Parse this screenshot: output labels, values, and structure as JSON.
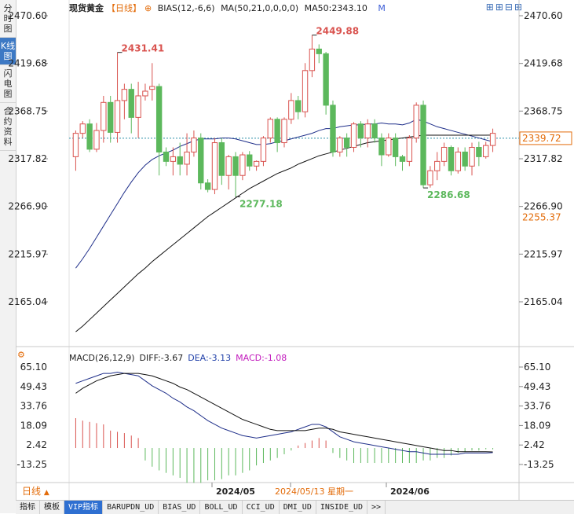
{
  "side_tabs": [
    {
      "label": "分时图",
      "active": false
    },
    {
      "label": "K线图",
      "active": true
    },
    {
      "label": "闪电图",
      "active": false
    },
    {
      "label": "合约资料",
      "active": false
    }
  ],
  "header": {
    "symbol": "现货黄金",
    "timeframe": "【日线】",
    "bias_label": "BIAS(12,-6,6)",
    "ma_label": "MA(50,21,0,0,0,0)",
    "ma_value": "MA50:2343.10",
    "m_label": "M"
  },
  "tools_icons": [
    "crosshair-icon",
    "zoom-in-icon",
    "zoom-out-icon",
    "layout-icon"
  ],
  "macd_header": {
    "label": "MACD(26,12,9)",
    "diff": "DIFF:-3.67",
    "dea": "DEA:-3.13",
    "macd": "MACD:-1.08"
  },
  "timeframe_select": "日线",
  "bottom_tabs": [
    "指标",
    "模板",
    "VIP指标",
    "BARUPDN_UD",
    "BIAS_UD",
    "BOLL_UD",
    "CCI_UD",
    "DMI_UD",
    "INSIDE_UD",
    ">>"
  ],
  "bottom_active_tab": "VIP指标",
  "colors": {
    "up": "#d9534f",
    "down": "#5cb85c",
    "ma_line": "#1f2f8a",
    "ma50_line": "#111111",
    "accent": "#e36c0a",
    "dea_line": "#111111"
  },
  "chart_data": [
    {
      "type": "candlestick",
      "title": "现货黄金",
      "y_ticks": [
        "2470.60",
        "2419.68",
        "2368.75",
        "2317.82",
        "2266.90",
        "2215.97",
        "2165.04"
      ],
      "ylim": [
        2125,
        2480
      ],
      "x_labels": [
        "2024/05",
        "2024/05/13 星期一",
        "2024/06"
      ],
      "last_price": "2339.72",
      "highlight_price": "2255.37",
      "annotations": [
        {
          "text": "2431.41",
          "value": 2431.41,
          "kind": "high"
        },
        {
          "text": "2449.88",
          "value": 2449.88,
          "kind": "high"
        },
        {
          "text": "2277.18",
          "value": 2277.18,
          "kind": "low"
        },
        {
          "text": "2286.68",
          "value": 2286.68,
          "kind": "low"
        }
      ],
      "candles": [
        [
          2320,
          2345,
          2305,
          2348
        ],
        [
          2345,
          2355,
          2340,
          2358
        ],
        [
          2355,
          2328,
          2325,
          2360
        ],
        [
          2328,
          2348,
          2325,
          2356
        ],
        [
          2348,
          2378,
          2335,
          2385
        ],
        [
          2378,
          2346,
          2335,
          2385
        ],
        [
          2346,
          2380,
          2335,
          2431.41
        ],
        [
          2380,
          2392,
          2360,
          2398
        ],
        [
          2392,
          2362,
          2345,
          2398
        ],
        [
          2362,
          2385,
          2340,
          2400
        ],
        [
          2385,
          2390,
          2380,
          2398
        ],
        [
          2392,
          2395,
          2380,
          2420
        ],
        [
          2395,
          2325,
          2300,
          2398
        ],
        [
          2325,
          2315,
          2310,
          2330
        ],
        [
          2315,
          2320,
          2300,
          2330
        ],
        [
          2320,
          2312,
          2300,
          2335
        ],
        [
          2312,
          2325,
          2300,
          2345
        ],
        [
          2325,
          2340,
          2320,
          2348
        ],
        [
          2340,
          2292,
          2285,
          2345
        ],
        [
          2292,
          2285,
          2282,
          2296
        ],
        [
          2285,
          2335,
          2280,
          2340
        ],
        [
          2335,
          2300,
          2290,
          2340
        ],
        [
          2300,
          2320,
          2285,
          2322
        ],
        [
          2320,
          2300,
          2277.18,
          2325
        ],
        [
          2300,
          2322,
          2295,
          2325
        ],
        [
          2322,
          2310,
          2305,
          2326
        ],
        [
          2310,
          2315,
          2305,
          2316
        ],
        [
          2315,
          2340,
          2310,
          2342
        ],
        [
          2340,
          2360,
          2335,
          2362
        ],
        [
          2360,
          2335,
          2325,
          2362
        ],
        [
          2335,
          2360,
          2330,
          2362
        ],
        [
          2360,
          2380,
          2355,
          2388
        ],
        [
          2380,
          2368,
          2360,
          2385
        ],
        [
          2368,
          2412,
          2362,
          2420
        ],
        [
          2412,
          2435,
          2405,
          2449.88
        ],
        [
          2435,
          2430,
          2420,
          2440
        ],
        [
          2430,
          2375,
          2365,
          2432
        ],
        [
          2375,
          2325,
          2320,
          2380
        ],
        [
          2325,
          2340,
          2320,
          2342
        ],
        [
          2340,
          2330,
          2320,
          2345
        ],
        [
          2330,
          2355,
          2325,
          2357
        ],
        [
          2355,
          2340,
          2330,
          2358
        ],
        [
          2340,
          2355,
          2330,
          2360
        ],
        [
          2355,
          2340,
          2335,
          2360
        ],
        [
          2340,
          2322,
          2310,
          2345
        ],
        [
          2322,
          2340,
          2320,
          2345
        ],
        [
          2340,
          2320,
          2310,
          2345
        ],
        [
          2320,
          2315,
          2305,
          2322
        ],
        [
          2315,
          2340,
          2310,
          2343
        ],
        [
          2340,
          2375,
          2335,
          2378
        ],
        [
          2375,
          2290,
          2286.68,
          2380
        ],
        [
          2290,
          2305,
          2287,
          2310
        ],
        [
          2305,
          2315,
          2295,
          2325
        ],
        [
          2315,
          2330,
          2310,
          2335
        ],
        [
          2330,
          2305,
          2300,
          2332
        ],
        [
          2305,
          2325,
          2302,
          2330
        ],
        [
          2325,
          2310,
          2305,
          2330
        ],
        [
          2310,
          2330,
          2300,
          2335
        ],
        [
          2330,
          2320,
          2310,
          2336
        ],
        [
          2320,
          2332,
          2318,
          2336
        ],
        [
          2332,
          2345,
          2325,
          2350
        ]
      ],
      "series": [
        {
          "name": "MA",
          "values": [
            2201,
            2211,
            2222,
            2234,
            2246,
            2258,
            2270,
            2282,
            2293,
            2303,
            2311,
            2317,
            2321,
            2324,
            2327,
            2331,
            2334,
            2337,
            2339,
            2339,
            2339,
            2340,
            2340,
            2339,
            2337,
            2335,
            2333,
            2333,
            2334,
            2336,
            2337,
            2339,
            2341,
            2343,
            2345,
            2348,
            2350,
            2350,
            2352,
            2353,
            2354,
            2354,
            2355,
            2355,
            2356,
            2355,
            2355,
            2354,
            2356,
            2360,
            2358,
            2355,
            2352,
            2350,
            2348,
            2346,
            2344,
            2342,
            2340,
            2338,
            2336
          ]
        },
        {
          "name": "MA50",
          "values": [
            2133,
            2139,
            2146,
            2153,
            2160,
            2167,
            2174,
            2181,
            2188,
            2195,
            2201,
            2208,
            2214,
            2220,
            2226,
            2232,
            2238,
            2244,
            2250,
            2256,
            2261,
            2266,
            2271,
            2276,
            2281,
            2286,
            2290,
            2294,
            2298,
            2302,
            2305,
            2308,
            2312,
            2315,
            2318,
            2321,
            2323,
            2325,
            2327,
            2329,
            2331,
            2333,
            2335,
            2336,
            2337,
            2338,
            2339,
            2340,
            2341,
            2342,
            2343,
            2343,
            2343,
            2343,
            2343,
            2343,
            2343,
            2343,
            2343,
            2343,
            2343.1
          ]
        }
      ]
    },
    {
      "type": "macd",
      "title": "MACD(26,12,9)",
      "y_ticks": [
        "65.10",
        "49.43",
        "33.76",
        "18.09",
        "2.42",
        "-13.25"
      ],
      "ylim": [
        -28,
        72
      ],
      "series": [
        {
          "name": "DIFF",
          "values": [
            52,
            54,
            56,
            58,
            60,
            60,
            61,
            60,
            59,
            58,
            54,
            50,
            47,
            44,
            40,
            37,
            33,
            30,
            26,
            22,
            19,
            16,
            14,
            12,
            10,
            9,
            8,
            9,
            10,
            11,
            12,
            13,
            15,
            17,
            19,
            19,
            17,
            13,
            9,
            7,
            5,
            4,
            3,
            2,
            1,
            0,
            -1,
            -2,
            -3,
            -3,
            -4,
            -5,
            -5,
            -5,
            -5,
            -5,
            -4,
            -4,
            -4,
            -4,
            -3.67
          ]
        },
        {
          "name": "DEA",
          "values": [
            44,
            48,
            51,
            54,
            56,
            58,
            59,
            60,
            60,
            60,
            59,
            58,
            56,
            54,
            52,
            49,
            47,
            44,
            41,
            38,
            35,
            32,
            29,
            26,
            23,
            21,
            19,
            17,
            15,
            14,
            14,
            14,
            14,
            14,
            15,
            16,
            16,
            15,
            13,
            12,
            11,
            10,
            9,
            8,
            7,
            6,
            5,
            4,
            3,
            2,
            1,
            0,
            -1,
            -2,
            -2,
            -3,
            -3,
            -3,
            -3,
            -3,
            -3.13
          ]
        },
        {
          "name": "MACD",
          "values": [
            24,
            22,
            21,
            20,
            19,
            14,
            13,
            12,
            10,
            8,
            -10,
            -15,
            -18,
            -20,
            -22,
            -24,
            -28,
            -28,
            -28,
            -26,
            -26,
            -25,
            -22,
            -22,
            -20,
            -18,
            -14,
            -12,
            -10,
            -8,
            -5,
            -2,
            2,
            4,
            6,
            8,
            6,
            -4,
            -8,
            -10,
            -12,
            -12,
            -12,
            -12,
            -12,
            -12,
            -12,
            -12,
            -12,
            -12,
            -10,
            -10,
            -8,
            -8,
            -6,
            -4,
            -3,
            -2,
            -2,
            -1,
            -1.08
          ]
        }
      ]
    }
  ]
}
